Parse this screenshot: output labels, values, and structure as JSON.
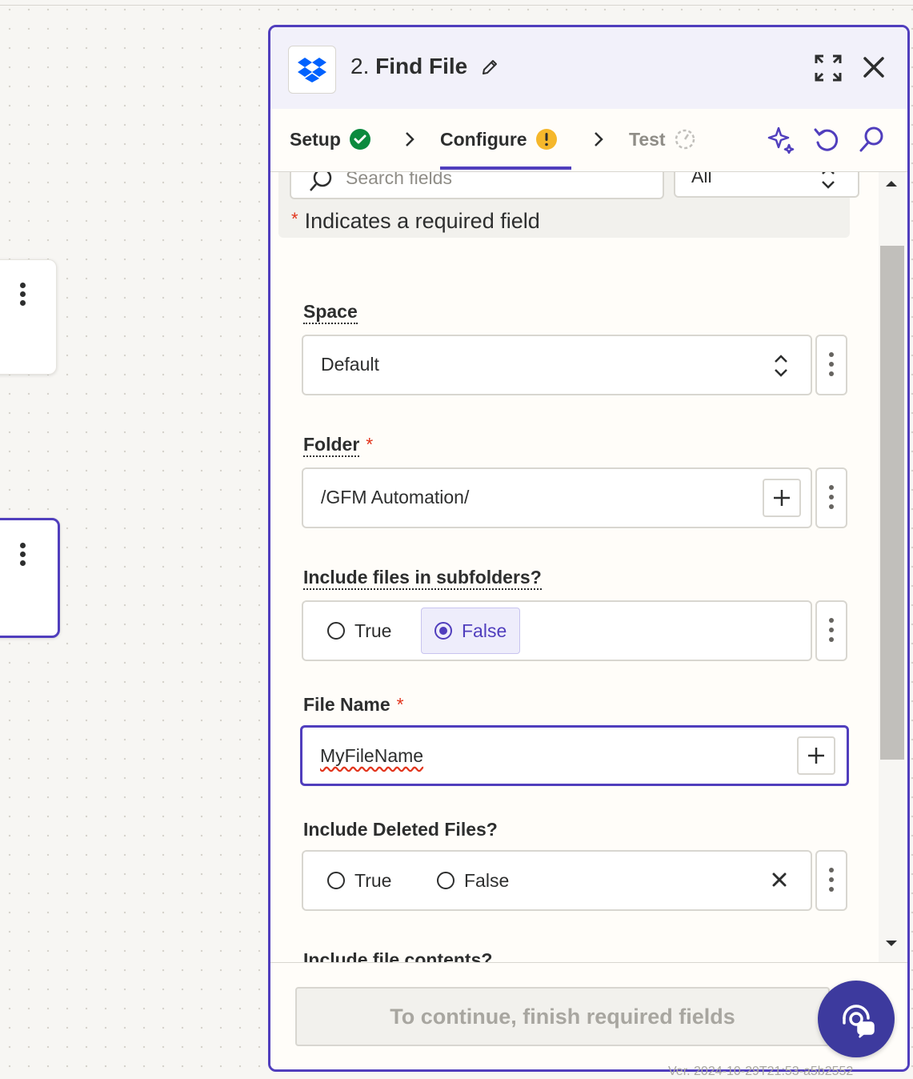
{
  "canvas": {
    "version_text": "Ver. 2024-10-29T21:53-a5b2552"
  },
  "panel": {
    "step_number": "2.",
    "title": "Find File",
    "app_icon": "dropbox-icon",
    "header_icons": [
      "pencil-icon",
      "expand-icon",
      "close-icon"
    ]
  },
  "steps": [
    {
      "label": "Setup",
      "status": "complete"
    },
    {
      "label": "Configure",
      "status": "warning",
      "active": true
    },
    {
      "label": "Test",
      "status": "disabled"
    }
  ],
  "toolbar_icons": [
    "sparkle-icon",
    "undo-icon",
    "search-icon"
  ],
  "filters": {
    "search_placeholder": "Search fields",
    "filter_value": "All"
  },
  "required_note": {
    "asterisk": "*",
    "text": "Indicates a required field"
  },
  "fields": {
    "space": {
      "label": "Space",
      "value": "Default"
    },
    "folder": {
      "label": "Folder",
      "required": "*",
      "value": "/GFM Automation/"
    },
    "subfolders": {
      "label": "Include files in subfolders?",
      "options": [
        "True",
        "False"
      ],
      "selected": "False"
    },
    "file_name": {
      "label": "File Name",
      "required": "*",
      "value": "MyFileName"
    },
    "deleted": {
      "label": "Include Deleted Files?",
      "options": [
        "True",
        "False"
      ],
      "selected": null
    },
    "contents": {
      "label": "Include file contents?"
    }
  },
  "footer": {
    "continue_label": "To continue, finish required fields"
  },
  "colors": {
    "accent": "#503ebd",
    "success": "#0b8a3e",
    "warning": "#f5b72b",
    "required": "#e2351d",
    "dropbox": "#0061fe"
  }
}
